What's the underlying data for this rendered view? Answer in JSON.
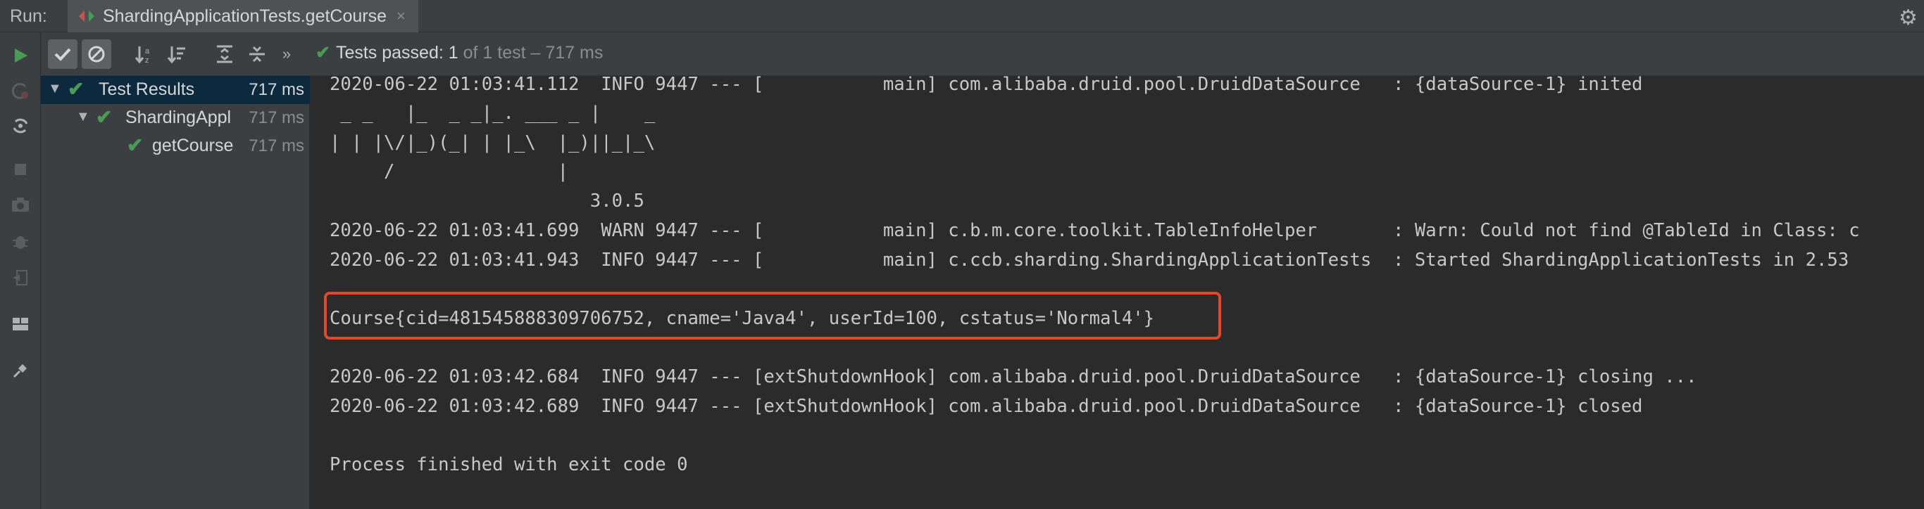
{
  "run_header": {
    "label": "Run:",
    "tab_title": "ShardingApplicationTests.getCourse",
    "tab_close": "×",
    "settings_icon": "gear-icon"
  },
  "sidebar_icons": [
    "run-icon",
    "rerun-failed-icon",
    "toggle-auto-test-icon",
    "stop-icon",
    "camera-icon",
    "debug-icon",
    "exit-icon",
    "layout-icon",
    "pin-icon"
  ],
  "test_toolbar": {
    "buttons": [
      "show-passed-icon",
      "show-ignored-icon",
      "sort-alpha-icon",
      "sort-duration-icon",
      "expand-all-icon",
      "collapse-all-icon",
      "more-icon"
    ],
    "status_check": "✔",
    "status_main": "Tests passed: 1",
    "status_sub": " of 1 test – 717 ms"
  },
  "tree": {
    "rows": [
      {
        "label": "Test Results",
        "time": "717 ms"
      },
      {
        "label": "ShardingAppl",
        "time": "717 ms"
      },
      {
        "label": "getCourse",
        "time": "717 ms"
      }
    ]
  },
  "console": {
    "lines": [
      "2020-06-22 01:03:41.112  INFO 9447 --- [           main] com.alibaba.druid.pool.DruidDataSource   : {dataSource-1} inited",
      " _ _   |_  _ _|_. ___ _ |    _",
      "| | |\\/|_)(_| | |_\\  |_)||_|_\\",
      "     /               |",
      "                        3.0.5",
      "2020-06-22 01:03:41.699  WARN 9447 --- [           main] c.b.m.core.toolkit.TableInfoHelper       : Warn: Could not find @TableId in Class: c",
      "2020-06-22 01:03:41.943  INFO 9447 --- [           main] c.ccb.sharding.ShardingApplicationTests  : Started ShardingApplicationTests in 2.53",
      "Course{cid=481545888309706752, cname='Java4', userId=100, cstatus='Normal4'}",
      "2020-06-22 01:03:42.684  INFO 9447 --- [extShutdownHook] com.alibaba.druid.pool.DruidDataSource   : {dataSource-1} closing ...",
      "2020-06-22 01:03:42.689  INFO 9447 --- [extShutdownHook] com.alibaba.druid.pool.DruidDataSource   : {dataSource-1} closed",
      "Process finished with exit code 0"
    ]
  },
  "colors": {
    "pass_green": "#499c54",
    "highlight_red": "#e5472b",
    "console_bg": "#2b2b2b",
    "panel_bg": "#3c3f41",
    "selection_bg": "#0d293e"
  }
}
